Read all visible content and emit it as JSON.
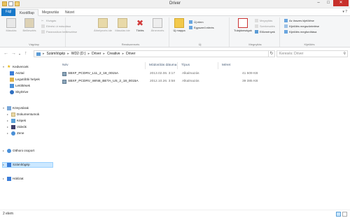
{
  "window": {
    "title": "Driver"
  },
  "ribbon_tabs": [
    "Fájl",
    "Kezdőlap",
    "Megosztás",
    "Nézet"
  ],
  "ribbon": {
    "vagolap": {
      "label": "Vágólap",
      "copy": "Másolás",
      "paste": "Beillesztés",
      "cut": "Kivágás",
      "copy_path": "Elérési út másolása",
      "paste_shortcut": "Parancsikon beillesztése"
    },
    "rendszerezes": {
      "label": "Rendszerezés",
      "move_to": "Áthelyezés ide",
      "copy_to": "Másolás ide",
      "delete": "Törlés",
      "rename": "Átnevezés"
    },
    "uj": {
      "label": "Új",
      "new_folder": "Új mappa",
      "new_item": "Új elem",
      "easy_access": "Egyszerű elérés"
    },
    "megnyitas": {
      "label": "Megnyitás",
      "properties": "Tulajdonságok",
      "open": "Megnyitás",
      "edit": "Szerkesztés",
      "history": "Előzmények"
    },
    "kijeloles": {
      "label": "Kijelölés",
      "select_all": "Az összes kijelölése",
      "select_none": "Kijelölés megszüntetése",
      "invert": "Kijelölés megfordítása"
    }
  },
  "address": {
    "crumbs": [
      "Számítógép",
      "WD2 (D:)",
      "Driver",
      "Creative",
      "Driver"
    ],
    "search_placeholder": "Keresés: Driver"
  },
  "nav_pane": {
    "favorites": "Kedvencek",
    "favorites_items": [
      "Asztal",
      "Legutóbbi helyek",
      "Letöltések",
      "SkyDrive"
    ],
    "libraries": "Könyvtárak",
    "libraries_items": [
      "Dokumentumok",
      "Képek",
      "Videók",
      "Zene"
    ],
    "homegroup": "Otthoni csoport",
    "computer": "Számítógép",
    "network": "Hálózat"
  },
  "columns": [
    "Név",
    "Módosítás dátuma",
    "Típus",
    "Méret"
  ],
  "files": [
    {
      "name": "SBXF_PCDRV_L11_2_18_0015A",
      "date": "2013.02.06. 3:17",
      "type": "Alkalmazás",
      "size": "41 509 KB"
    },
    {
      "name": "SBXF_PCDRV_WIN8_BETA_US_2_18_0015A",
      "date": "2012.10.26. 3:58",
      "type": "Alkalmazás",
      "size": "39 385 KB"
    }
  ],
  "status": {
    "count": "2 elem"
  },
  "colors": {
    "accent": "#1979ca",
    "close": "#c7302b",
    "selected_bg": "#cce8ff"
  }
}
